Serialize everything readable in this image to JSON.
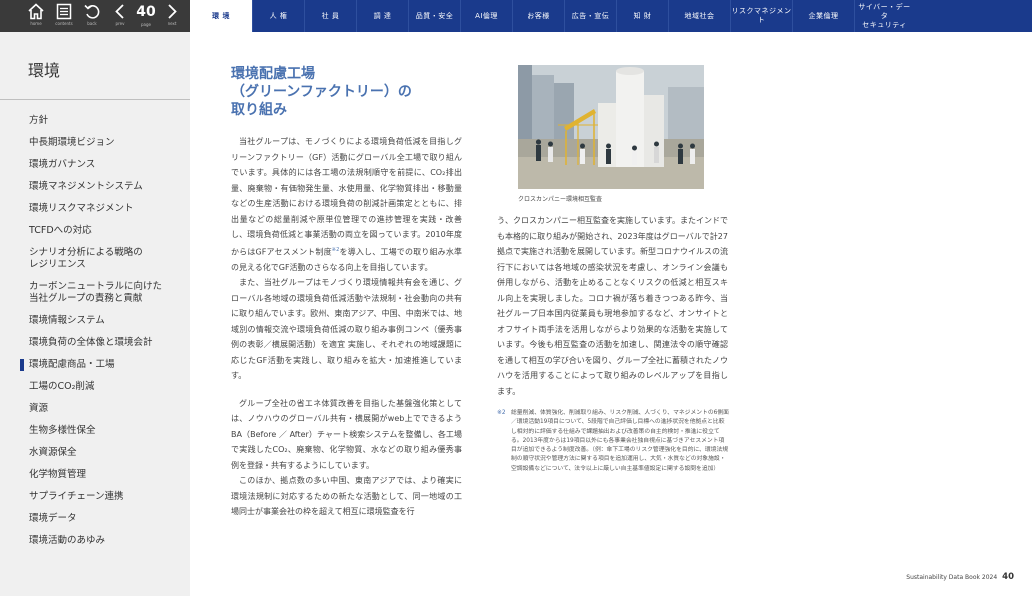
{
  "toolbar": {
    "home_label": "home",
    "contents_label": "contents",
    "back_label": "back",
    "prev_label": "prev",
    "page_label": "page",
    "page_number": "40",
    "next_label": "next"
  },
  "tabs": [
    {
      "label": "環 境",
      "active": true
    },
    {
      "label": "人 権"
    },
    {
      "label": "社 員"
    },
    {
      "label": "調 達"
    },
    {
      "label": "品質・安全"
    },
    {
      "label": "AI倫理"
    },
    {
      "label": "お客様"
    },
    {
      "label": "広告・宣伝"
    },
    {
      "label": "知 財"
    },
    {
      "label": "地域社会"
    },
    {
      "label": "リスクマネジメント"
    },
    {
      "label": "企業倫理"
    },
    {
      "label": "サイバー・データ\nセキュリティ"
    }
  ],
  "sidebar": {
    "title": "環境",
    "items": [
      {
        "label": "方針"
      },
      {
        "label": "中長期環境ビジョン"
      },
      {
        "label": "環境ガバナンス"
      },
      {
        "label": "環境マネジメントシステム"
      },
      {
        "label": "環境リスクマネジメント"
      },
      {
        "label": "TCFDへの対応"
      },
      {
        "label": "シナリオ分析による戦略の\nレジリエンス"
      },
      {
        "label": "カーボンニュートラルに向けた\n当社グループの責務と貢献"
      },
      {
        "label": "環境情報システム"
      },
      {
        "label": "環境負荷の全体像と環境会計"
      },
      {
        "label": "環境配慮商品・工場",
        "active": true
      },
      {
        "label": "工場のCO₂削減"
      },
      {
        "label": "資源"
      },
      {
        "label": "生物多様性保全"
      },
      {
        "label": "水資源保全"
      },
      {
        "label": "化学物質管理"
      },
      {
        "label": "サプライチェーン連携"
      },
      {
        "label": "環境データ"
      },
      {
        "label": "環境活動のあゆみ"
      }
    ]
  },
  "article": {
    "heading_line1": "環境配慮工場",
    "heading_line2": "（グリーンファクトリー）の",
    "heading_line3": "取り組み",
    "para1a": "当社グループは、モノづくりによる環境負荷低減を目指しグリーンファクトリー（GF）活動にグローバル全工場で取り組んでいます。具体的には各工場の法規制順守を前提に、CO₂排出量、廃棄物・有価物発生量、水使用量、化学物質排出・移動量などの生産活動における環境負荷の削減計画策定とともに、排出量などの総量削減や原単位管理での進捗管理を実践・改善し、環境負荷低減と事業活動の両立を図っています。2010年度からはGFアセスメント制度",
    "para1_ref": "※2",
    "para1b": "を導入し、工場での取り組み水準の見える化でGF活動のさらなる向上を目指しています。",
    "para2": "また、当社グループはモノづくり環境情報共有会を通じ、グローバル各地域の環境負荷低減活動や法規制・社会動向の共有に取り組んでいます。欧州、東南アジア、中国、中南米では、地域別の情報交流や環境負荷低減の取り組み事例コンペ（優秀事例の表彰／横展開活動）を適宜 実施し、それぞれの地域課題に応じたGF活動を実践し、取り組みを拡大・加速推進しています。",
    "para3": "グループ全社の省エネ体質改善を目指した基盤強化策としては、ノウハウのグローバル共有・横展開がweb上でできるようBA（Before ／ After）チャート検索システムを整備し、各工場で実践したCO₂、廃棄物、化学物質、水などの取り組み優秀事例を登録・共有するようにしています。",
    "para4": "このほか、拠点数の多い中国、東南アジアでは、より確実に環境法規制に対応するための新たな活動として、同一地域の工場同士が事業会社の枠を超えて相互に環境監査を行",
    "photo_caption": "クロスカンパニー環境相互監査",
    "right_para": "う、クロスカンパニー相互監査を実施しています。またインドでも本格的に取り組みが開始され、2023年度はグローバルで計27拠点で実施され活動を展開しています。新型コロナウイルスの流行下においては各地域の感染状況を考慮し、オンライン会議も併用しながら、活動を止めることなくリスクの低減と相互スキル向上を実現しました。コロナ禍が落ち着きつつある昨今、当社グループ日本国内従業員も現地参加するなど、オンサイトとオフサイト両手法を活用しながらより効果的な活動を実施しています。今後も相互監査の活動を加速し、関連法令の順守確認を通して相互の学び合いを図り、グループ全社に蓄積されたノウハウを活用することによって取り組みのレベルアップを目指します。",
    "note_mark": "※2",
    "note_text": "総量削減、体質強化、削減取り組み、リスク削減、人づくり、マネジメントの6側面／環境活動19項目について、5段階で自己評価し目標への進捗状況を他拠点と比較し相対的に評価する仕組みで課題抽出および改善策の自主的検討・推進に役立てる。2013年度からは19項目以外にも各事業会社独自視点に基づきアセスメント項目が追加できるよう制度改善。（例：傘下工場のリスク管理強化を目的に、環境法規制の順守状況や管理方法に関する項目を追加運用し、大気・水質などの対象施設・空調設備などについて、法令以上に厳しい自主基準値設定に関する設問を追加）"
  },
  "footer": {
    "title": "Sustainability Data Book 2024",
    "page": "40"
  },
  "colors": {
    "nav_bar": "#1a3a8c",
    "toolbar": "#3a3a3a",
    "heading": "#4a72b0",
    "sidebar_bg": "#f0f0f0"
  }
}
